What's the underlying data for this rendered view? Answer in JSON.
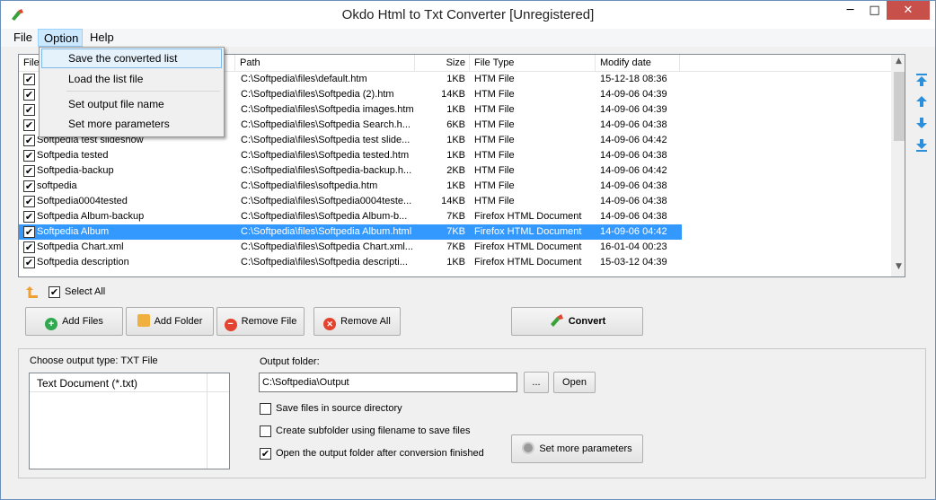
{
  "window": {
    "title": "Okdo Html to Txt Converter [Unregistered]"
  },
  "titlebar_buttons": {
    "minimize": "─",
    "maximize": "□",
    "close": "✕"
  },
  "menubar": {
    "file": "File",
    "option": "Option",
    "help": "Help"
  },
  "option_menu": {
    "save_list": "Save the converted list",
    "load_list": "Load the list file",
    "set_output_name": "Set output file name",
    "set_more_params": "Set more parameters"
  },
  "list": {
    "headers": {
      "file": "File",
      "path": "Path",
      "size": "Size",
      "type": "File Type",
      "date": "Modify date"
    },
    "rows": [
      {
        "name": "",
        "path": "C:\\Softpedia\\files\\default.htm",
        "size": "1KB",
        "type": "HTM File",
        "date": "15-12-18 08:36",
        "checked": true
      },
      {
        "name": "",
        "path": "C:\\Softpedia\\files\\Softpedia (2).htm",
        "size": "14KB",
        "type": "HTM File",
        "date": "14-09-06 04:39",
        "checked": true
      },
      {
        "name": "",
        "path": "C:\\Softpedia\\files\\Softpedia images.htm",
        "size": "1KB",
        "type": "HTM File",
        "date": "14-09-06 04:39",
        "checked": true
      },
      {
        "name": "",
        "path": "C:\\Softpedia\\files\\Softpedia Search.h...",
        "size": "6KB",
        "type": "HTM File",
        "date": "14-09-06 04:38",
        "checked": true
      },
      {
        "name": "Softpedia test slideshow",
        "path": "C:\\Softpedia\\files\\Softpedia test slide...",
        "size": "1KB",
        "type": "HTM File",
        "date": "14-09-06 04:42",
        "checked": true
      },
      {
        "name": "Softpedia tested",
        "path": "C:\\Softpedia\\files\\Softpedia tested.htm",
        "size": "1KB",
        "type": "HTM File",
        "date": "14-09-06 04:38",
        "checked": true
      },
      {
        "name": "Softpedia-backup",
        "path": "C:\\Softpedia\\files\\Softpedia-backup.h...",
        "size": "2KB",
        "type": "HTM File",
        "date": "14-09-06 04:42",
        "checked": true
      },
      {
        "name": "softpedia",
        "path": "C:\\Softpedia\\files\\softpedia.htm",
        "size": "1KB",
        "type": "HTM File",
        "date": "14-09-06 04:38",
        "checked": true
      },
      {
        "name": "Softpedia0004tested",
        "path": "C:\\Softpedia\\files\\Softpedia0004teste...",
        "size": "14KB",
        "type": "HTM File",
        "date": "14-09-06 04:38",
        "checked": true
      },
      {
        "name": "Softpedia Album-backup",
        "path": "C:\\Softpedia\\files\\Softpedia Album-b...",
        "size": "7KB",
        "type": "Firefox HTML Document",
        "date": "14-09-06 04:38",
        "checked": true
      },
      {
        "name": "Softpedia Album",
        "path": "C:\\Softpedia\\files\\Softpedia Album.html",
        "size": "7KB",
        "type": "Firefox HTML Document",
        "date": "14-09-06 04:42",
        "checked": true,
        "selected": true
      },
      {
        "name": "Softpedia Chart.xml",
        "path": "C:\\Softpedia\\files\\Softpedia Chart.xml...",
        "size": "7KB",
        "type": "Firefox HTML Document",
        "date": "16-01-04 00:23",
        "checked": true
      },
      {
        "name": "Softpedia description",
        "path": "C:\\Softpedia\\files\\Softpedia descripti...",
        "size": "1KB",
        "type": "Firefox HTML Document",
        "date": "15-03-12 04:39",
        "checked": true
      }
    ],
    "check_mark": "✔"
  },
  "select_all": {
    "label": "Select All",
    "checked": true
  },
  "buttons": {
    "add_files": "Add Files",
    "add_folder": "Add Folder",
    "remove_file": "Remove File",
    "remove_all": "Remove All",
    "convert": "Convert",
    "browse": "...",
    "open": "Open",
    "more_params": "Set more parameters"
  },
  "output": {
    "type_label": "Choose output type:  TXT File",
    "type_item": "Text Document (*.txt)",
    "folder_label": "Output folder:",
    "folder_value": "C:\\Softpedia\\Output"
  },
  "options": {
    "save_in_source": {
      "label": "Save files in source directory",
      "checked": false
    },
    "create_subfolder": {
      "label": "Create subfolder using filename to save files",
      "checked": false
    },
    "open_output": {
      "label": "Open the output folder after conversion finished",
      "checked": true
    }
  },
  "colors": {
    "selection": "#3399ff",
    "menu_highlight": "#cce8ff",
    "close_button": "#c7504b",
    "arrow_blue": "#2b8fdc"
  }
}
